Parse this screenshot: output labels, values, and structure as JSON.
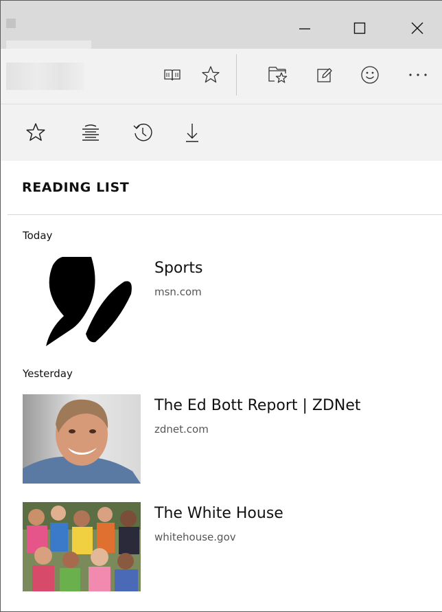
{
  "titlebar": {
    "icons": {
      "minimize": "minimize-icon",
      "maximize": "maximize-icon",
      "close": "close-icon"
    }
  },
  "toolbar": {
    "icons": [
      "reading-view-icon",
      "favorite-star-icon",
      "hub-icon",
      "web-note-icon",
      "feedback-smiley-icon",
      "more-dots-icon"
    ]
  },
  "hub_tabs": {
    "icons": [
      "favorites-star-icon",
      "reading-list-icon",
      "history-icon",
      "downloads-icon"
    ]
  },
  "panel": {
    "title": "READING LIST",
    "groups": [
      {
        "label": "Today",
        "items": [
          {
            "title": "Sports",
            "domain": "msn.com",
            "thumbnail": "msn-butterfly-logo"
          }
        ]
      },
      {
        "label": "Yesterday",
        "items": [
          {
            "title": "The Ed Bott Report | ZDNet",
            "domain": "zdnet.com",
            "thumbnail": "portrait-photo"
          },
          {
            "title": "The White House",
            "domain": "whitehouse.gov",
            "thumbnail": "crowd-photo"
          }
        ]
      }
    ]
  },
  "colors": {
    "titlebar_bg": "#dadada",
    "toolbar_bg": "#f2f2f2",
    "panel_bg": "#ffffff",
    "text": "#111111",
    "secondary_text": "#555555"
  }
}
